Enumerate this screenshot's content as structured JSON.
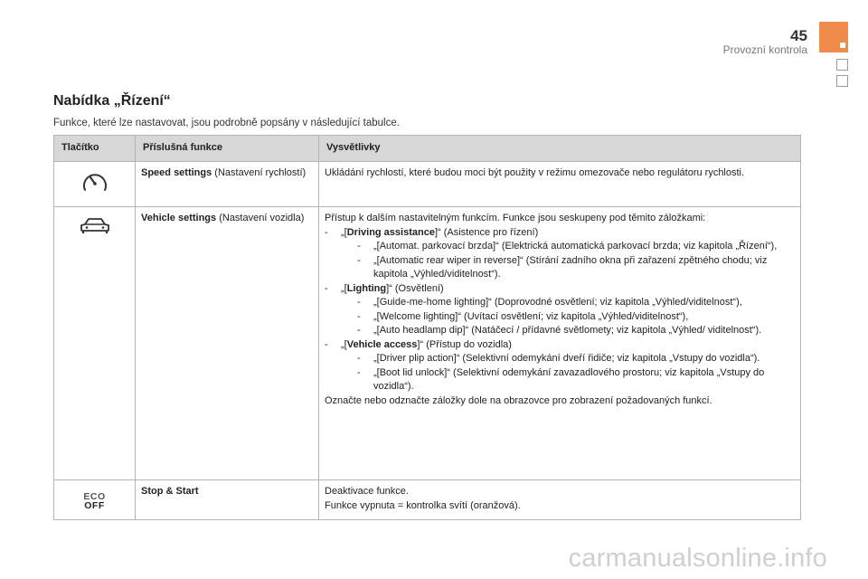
{
  "header": {
    "page_number": "45",
    "section": "Provozní kontrola"
  },
  "title": "Nabídka „Řízení“",
  "intro": "Funkce, které lze nastavovat, jsou podrobně popsány v následující tabulce.",
  "table": {
    "headers": [
      "Tlačítko",
      "Příslušná funkce",
      "Vysvětlivky"
    ],
    "rows": [
      {
        "icon": "speedometer-icon",
        "function_bold": "Speed settings",
        "function_rest": " (Nastavení rychlostí)",
        "explanation": "Ukládání rychlostí, které budou moci být použity v režimu omezovače nebo regulátoru rychlosti."
      },
      {
        "icon": "car-icon",
        "function_bold": "Vehicle settings",
        "function_rest": " (Nastavení vozidla)",
        "intro": "Přístup k dalším nastavitelným funkcím. Funkce jsou seskupeny pod těmito záložkami:",
        "groups": [
          {
            "pre": "„[",
            "name": "Driving assistance",
            "post": "]“ (Asistence pro řízení)",
            "items": [
              "„[Automat. parkovací brzda]“ (Elektrická automatická parkovací brzda; viz kapitola „Řízení“),",
              "„[Automatic rear wiper in reverse]“ (Stírání zadního okna při zařazení zpětného chodu; viz kapitola „Výhled/viditelnost“)."
            ]
          },
          {
            "pre": "„[",
            "name": "Lighting",
            "post": "]“ (Osvětlení)",
            "items": [
              "„[Guide-me-home lighting]“ (Doprovodné osvětlení; viz kapitola „Výhled/viditelnost“),",
              "„[Welcome lighting]“ (Uvítací osvětlení; viz kapitola „Výhled/viditelnost“),",
              "„[Auto headlamp dip]“ (Natáčecí / přídavné světlomety; viz kapitola „Výhled/ viditelnost“)."
            ]
          },
          {
            "pre": "„[",
            "name": "Vehicle access",
            "post": "]“ (Přístup do vozidla)",
            "items": [
              "„[Driver plip action]“ (Selektivní odemykání dveří řidiče; viz kapitola „Vstupy do vozidla“).",
              "„[Boot lid unlock]“ (Selektivní odemykání zavazadlového prostoru; viz kapitola „Vstupy do vozidla“)."
            ]
          }
        ],
        "outro": "Označte nebo odznačte záložky dole na obrazovce pro zobrazení požadovaných funkcí."
      },
      {
        "icon": "eco-off-icon",
        "eco_top": "ECO",
        "eco_bottom": "OFF",
        "function_bold": "Stop & Start",
        "function_rest": "",
        "explanation_lines": [
          "Deaktivace funkce.",
          "Funkce vypnuta = kontrolka svítí (oranžová)."
        ]
      }
    ]
  },
  "watermark": "carmanualsonline.info"
}
